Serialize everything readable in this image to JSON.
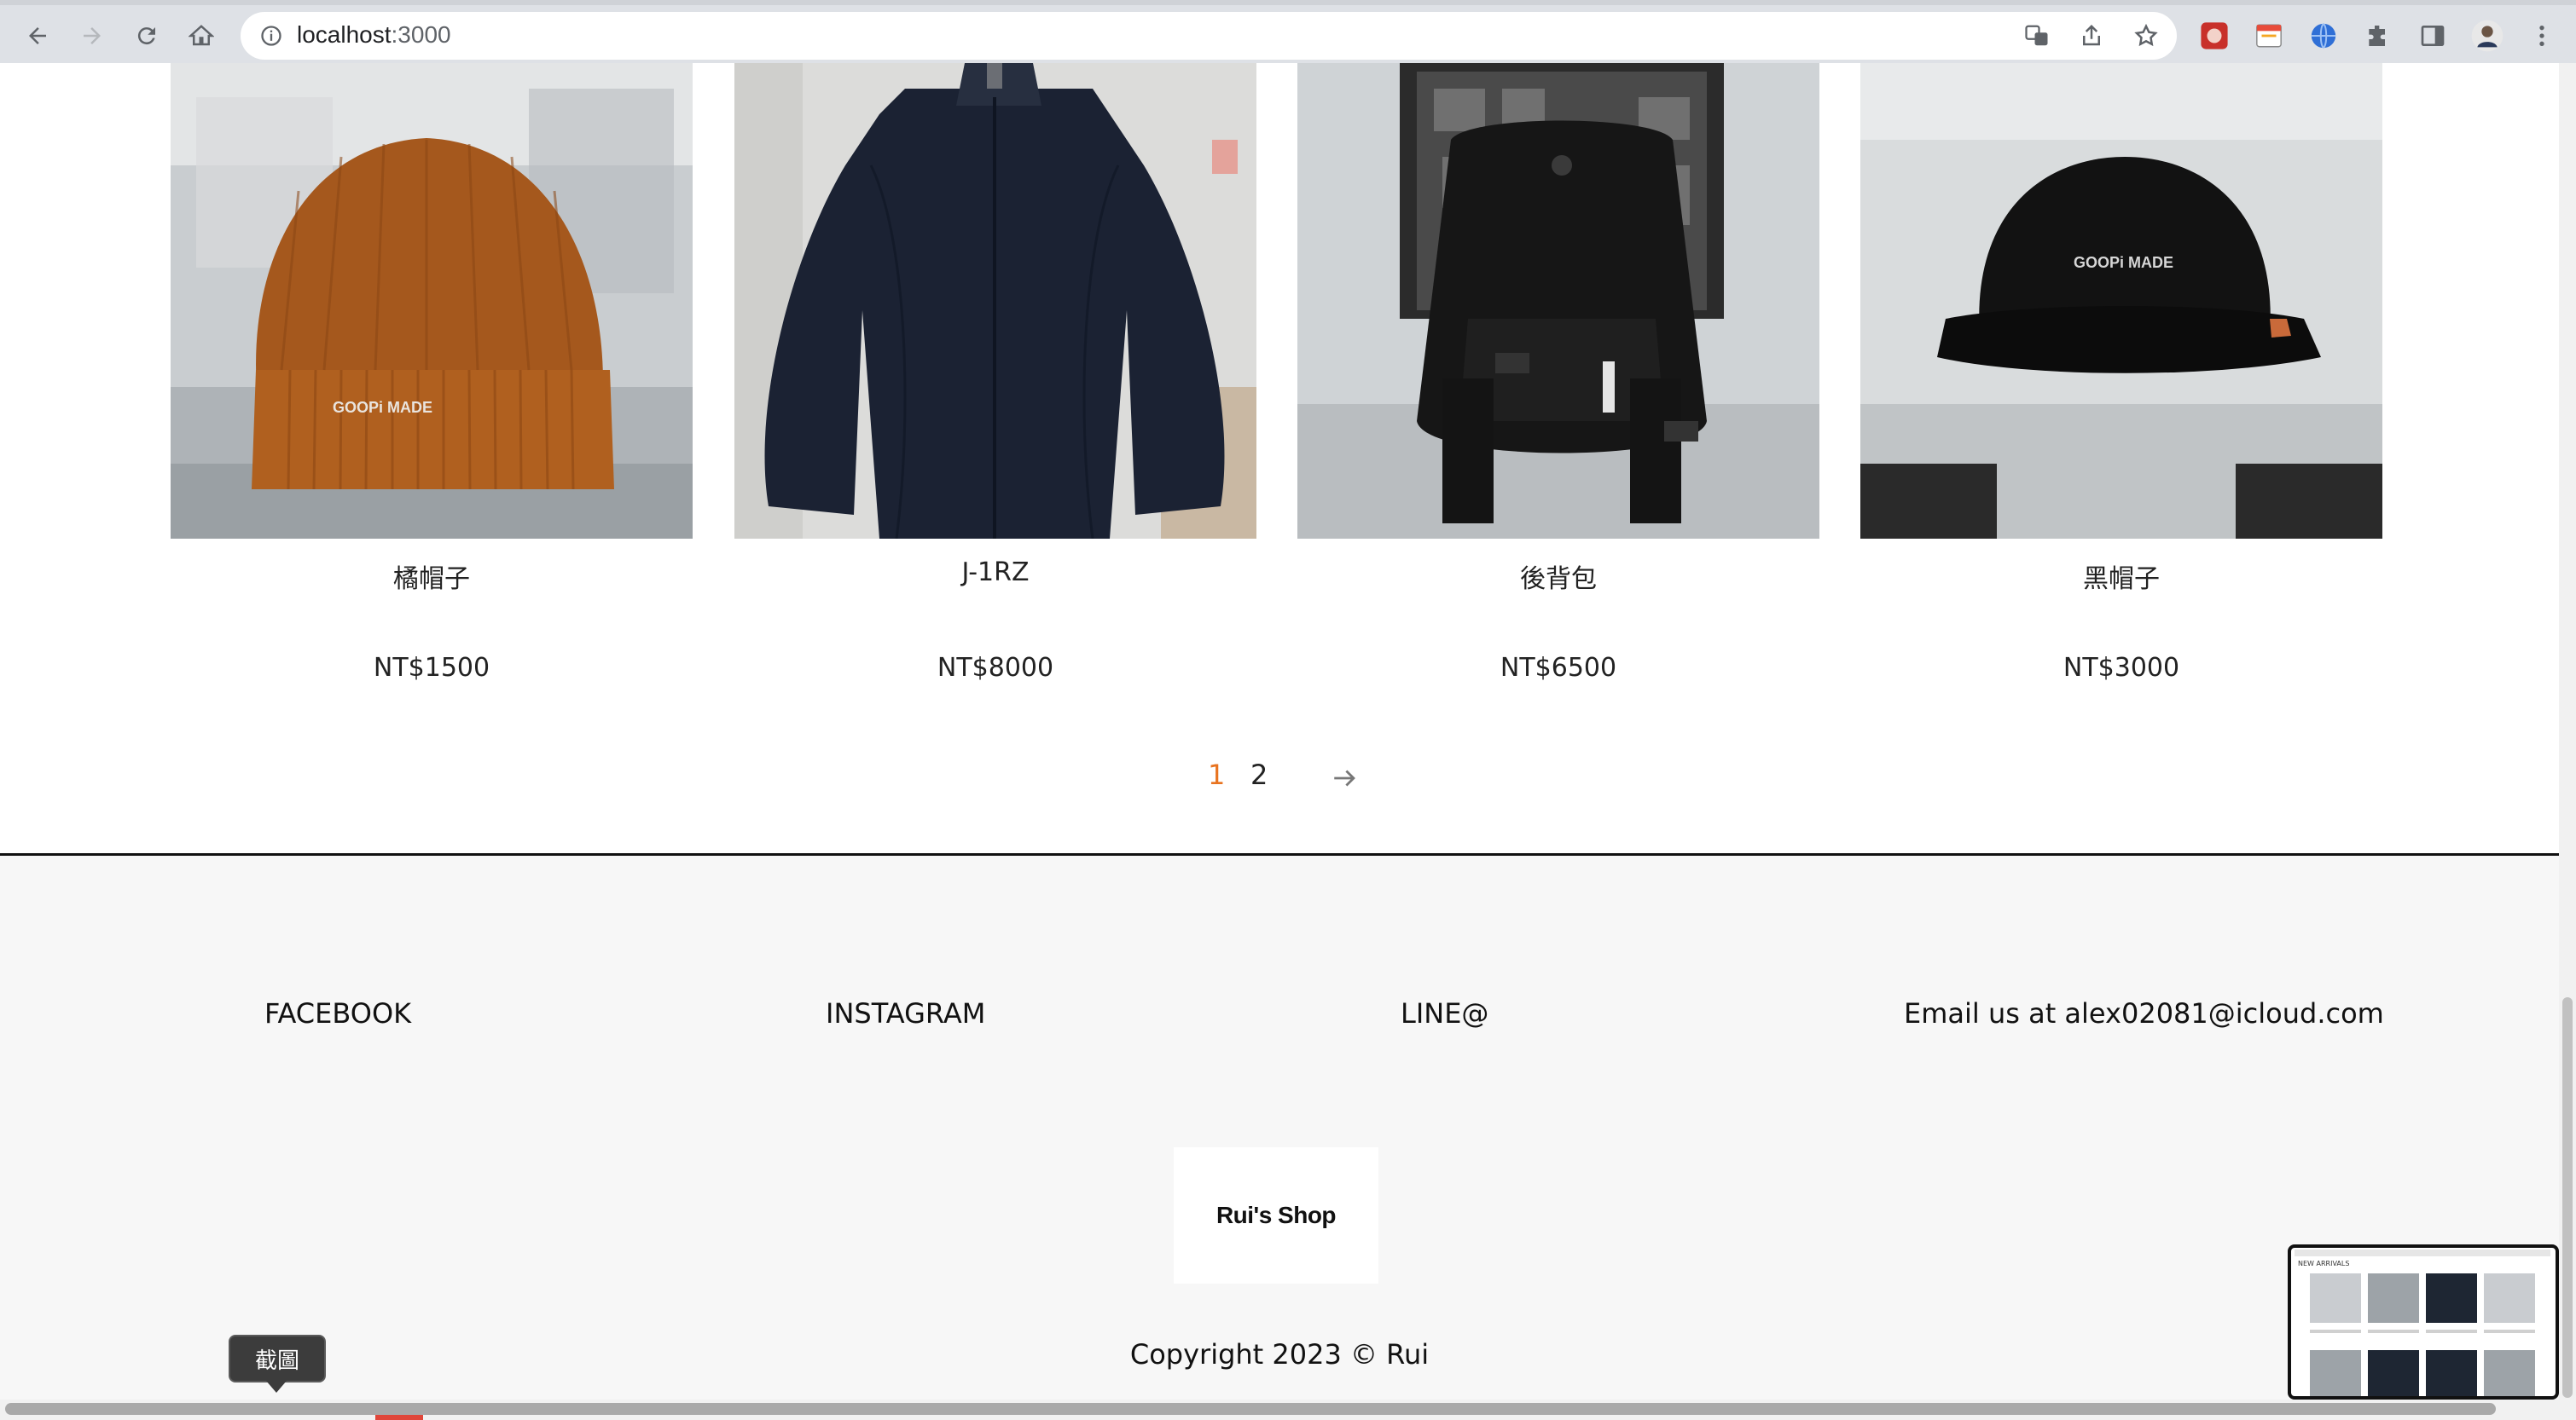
{
  "browser": {
    "url_host": "localhost",
    "url_port": ":3000"
  },
  "products": [
    {
      "name": "橘帽子",
      "price": "NT$1500",
      "image": "orange-beanie"
    },
    {
      "name": "J-1RZ",
      "price": "NT$8000",
      "image": "navy-jacket"
    },
    {
      "name": "後背包",
      "price": "NT$6500",
      "image": "black-backpack"
    },
    {
      "name": "黑帽子",
      "price": "NT$3000",
      "image": "black-cap"
    }
  ],
  "product_image_text": {
    "beanie_logo": "GOOPi MADE",
    "cap_logo": "GOOPi MADE"
  },
  "pagination": {
    "pages": [
      "1",
      "2"
    ],
    "current": "1",
    "next_icon": "arrow-right-icon"
  },
  "footer": {
    "facebook": "FACEBOOK",
    "instagram": "INSTAGRAM",
    "line": "LINE@",
    "email": "Email us at alex02081@icloud.com",
    "logo": "Rui's Shop",
    "copyright": "Copyright 2023 © Rui"
  },
  "tooltip": {
    "text": "截圖"
  },
  "preview": {
    "label": "NEW ARRIVALS"
  },
  "colors": {
    "accent_active_page": "#e8731f",
    "footer_bg": "#f7f7f7"
  }
}
